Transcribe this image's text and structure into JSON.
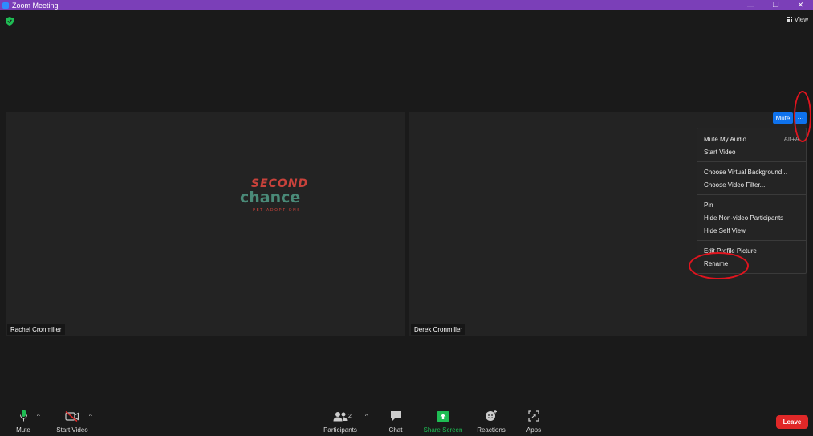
{
  "window": {
    "title": "Zoom Meeting",
    "controls": {
      "minimize": "—",
      "restore": "❐",
      "close": "✕"
    }
  },
  "top": {
    "view_label": "View"
  },
  "tiles": {
    "left": {
      "name": "Rachel Cronmiller",
      "logo": {
        "line1": "SECOND",
        "line2": "chance",
        "line3": "PET ADOPTIONS"
      }
    },
    "right": {
      "name": "Derek Cronmiller",
      "mute_label": "Mute",
      "more_label": "···"
    }
  },
  "context_menu": {
    "items": [
      {
        "label": "Mute My Audio",
        "shortcut": "Alt+A"
      },
      {
        "label": "Start Video"
      },
      {
        "label": "Choose Virtual Background..."
      },
      {
        "label": "Choose Video Filter..."
      },
      {
        "label": "Pin"
      },
      {
        "label": "Hide Non-video Participants"
      },
      {
        "label": "Hide Self View"
      },
      {
        "label": "Edit Profile Picture"
      },
      {
        "label": "Rename"
      }
    ]
  },
  "toolbar": {
    "mute": "Mute",
    "start_video": "Start Video",
    "participants": "Participants",
    "participants_count": "2",
    "chat": "Chat",
    "share_screen": "Share Screen",
    "reactions": "Reactions",
    "apps": "Apps",
    "leave": "Leave",
    "caret": "^"
  },
  "colors": {
    "title_bar": "#7b3fb8",
    "accent_blue": "#0e72ed",
    "share_green": "#1fbd54",
    "leave_red": "#e02828",
    "annotation_red": "#e0141e"
  }
}
